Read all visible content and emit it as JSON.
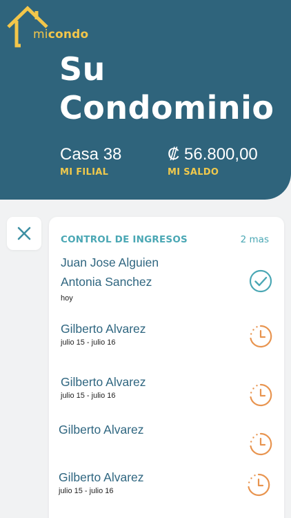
{
  "brand": {
    "mi": "mi",
    "condo": "condo"
  },
  "header": {
    "title_line1": "Su",
    "title_line2": "Condominio",
    "filial_value": "Casa 38",
    "filial_label": "MI FILIAL",
    "saldo_value": "₡ 56.800,00",
    "saldo_label": "MI SALDO"
  },
  "colors": {
    "header_bg": "#2f647c",
    "accent_yellow": "#f0c94c",
    "teal": "#4aa7b4",
    "orange_pending": "#e8944f"
  },
  "card": {
    "title": "CONTROL DE INGRESOS",
    "more": "2 mas",
    "entries": [
      {
        "names": [
          "Juan Jose Alguien",
          "Antonia Sanchez"
        ],
        "sub": "hoy",
        "status": "approved",
        "icon": "check-circle-icon"
      },
      {
        "names": [
          "Gilberto Alvarez"
        ],
        "sub": "julio 15 - julio 16",
        "status": "pending",
        "icon": "clock-icon"
      },
      {
        "names": [
          "Gilberto Alvarez"
        ],
        "sub": "julio 15 - julio 16",
        "status": "pending",
        "icon": "clock-icon"
      },
      {
        "names": [
          "Gilberto Alvarez"
        ],
        "sub": "",
        "status": "pending",
        "icon": "clock-icon"
      },
      {
        "names": [
          "Gilberto Alvarez"
        ],
        "sub": "julio 15 - julio 16",
        "status": "pending",
        "icon": "clock-icon"
      }
    ]
  },
  "close_icon": "close-icon"
}
